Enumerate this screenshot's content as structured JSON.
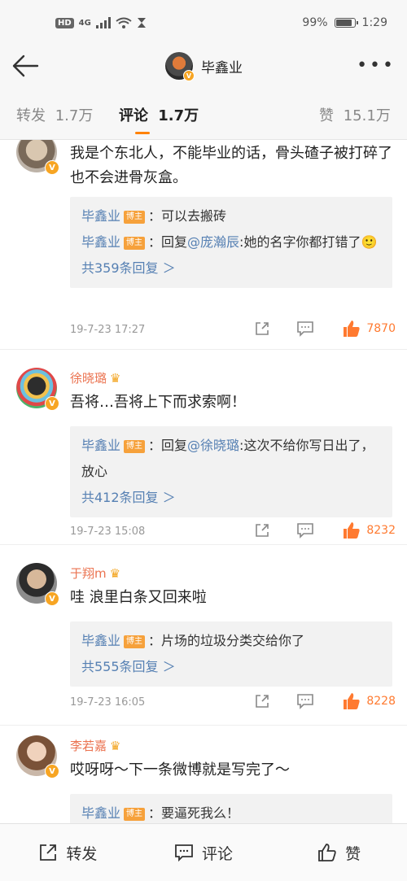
{
  "status": {
    "hd": "HD",
    "signal": "4G",
    "battery": "99%",
    "time": "1:29"
  },
  "nav": {
    "title": "毕鑫业",
    "more": "•••"
  },
  "tabs": {
    "repost_label": "转发",
    "repost_count": "1.7万",
    "comment_label": "评论",
    "comment_count": "1.7万",
    "like_label": "赞",
    "like_count": "15.1万"
  },
  "badge": {
    "vip": "V",
    "author": "博主"
  },
  "comments": [
    {
      "text": "我是个东北人，不能毕业的话，骨头碴子被打碎了也不会进骨灰盒。",
      "replies": [
        {
          "name": "毕鑫业",
          "prefix": "：",
          "text": "可以去搬砖"
        },
        {
          "name": "毕鑫业",
          "prefix": "：回复",
          "mention": "@庞瀚辰",
          "text": ":她的名字你都打错了🙂"
        }
      ],
      "more_replies": "共359条回复 ＞",
      "time": "19-7-23 17:27",
      "likes": "7870"
    },
    {
      "author": "徐晓璐",
      "text": "吾将…吾将上下而求索啊！",
      "replies": [
        {
          "name": "毕鑫业",
          "prefix": "：回复",
          "mention": "@徐晓璐",
          "text": ":这次不给你写日出了，放心"
        }
      ],
      "more_replies": "共412条回复 ＞",
      "time": "19-7-23 15:08",
      "likes": "8232"
    },
    {
      "author": "于翔m",
      "text": "哇 浪里白条又回来啦",
      "replies": [
        {
          "name": "毕鑫业",
          "prefix": "：",
          "text": "片场的垃圾分类交给你了"
        }
      ],
      "more_replies": "共555条回复 ＞",
      "time": "19-7-23 16:05",
      "likes": "8228"
    },
    {
      "author": "李若嘉",
      "text": "哎呀呀～下一条微博就是写完了～",
      "replies": [
        {
          "name": "毕鑫业",
          "prefix": "：",
          "text": "要逼死我么！"
        }
      ]
    }
  ],
  "bottom": {
    "repost": "转发",
    "comment": "评论",
    "like": "赞"
  },
  "colors": {
    "accent": "#ff8200",
    "link": "#5680b3",
    "author": "#eb7350"
  }
}
